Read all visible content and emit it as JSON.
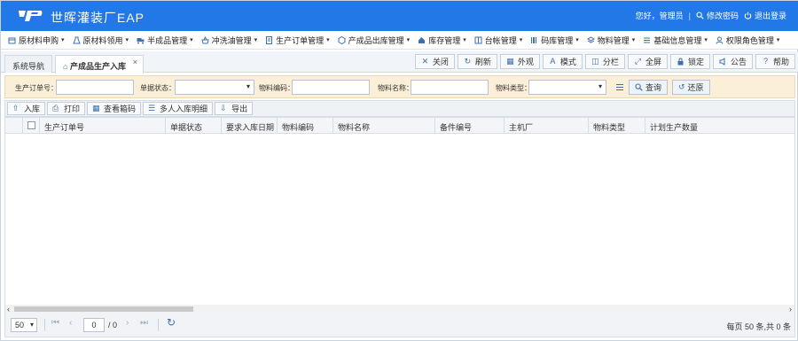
{
  "header": {
    "title": "世晖灌装厂EAP",
    "greeting": "您好，管理员",
    "separator": "|",
    "change_password": "修改密码",
    "logout": "退出登录",
    "brand_color": "#2178e6"
  },
  "menu": [
    {
      "label": "原材料申购",
      "icon": "box-icon"
    },
    {
      "label": "原材料领用",
      "icon": "flask-icon"
    },
    {
      "label": "半成品管理",
      "icon": "truck-icon"
    },
    {
      "label": "冲洗油管理",
      "icon": "basket-icon"
    },
    {
      "label": "生产订单管理",
      "icon": "document-icon"
    },
    {
      "label": "产成品出库管理",
      "icon": "cube-icon"
    },
    {
      "label": "库存管理",
      "icon": "home-icon"
    },
    {
      "label": "台帐管理",
      "icon": "book-icon"
    },
    {
      "label": "码库管理",
      "icon": "barcode-icon"
    },
    {
      "label": "物料管理",
      "icon": "layers-icon"
    },
    {
      "label": "基础信息管理",
      "icon": "sliders-icon"
    },
    {
      "label": "权限角色管理",
      "icon": "user-icon"
    }
  ],
  "tabs": [
    {
      "label": "系统导航"
    },
    {
      "label": "产成品生产入库",
      "close": "×"
    }
  ],
  "tab_tools": [
    {
      "label": "关闭",
      "icon": "close-icon",
      "glyph": "✕"
    },
    {
      "label": "刷新",
      "icon": "refresh-icon",
      "glyph": "↻"
    },
    {
      "label": "外观",
      "icon": "grid-icon",
      "glyph": "▦"
    },
    {
      "label": "模式",
      "icon": "font-icon",
      "glyph": "A"
    },
    {
      "label": "分栏",
      "icon": "columns-icon",
      "glyph": "◫"
    },
    {
      "label": "全屏",
      "icon": "fullscreen-icon",
      "glyph": "⤢"
    },
    {
      "label": "锁定",
      "icon": "lock-icon",
      "glyph": "🔒"
    },
    {
      "label": "公告",
      "icon": "speaker-icon",
      "glyph": "◀"
    },
    {
      "label": "帮助",
      "icon": "help-icon",
      "glyph": "?"
    }
  ],
  "filter": {
    "order_no_label": "生产订单号：",
    "status_label": "单据状态：",
    "material_code_label": "物料编码：",
    "material_name_label": "物料名称：",
    "material_type_label": "物料类型：",
    "search_label": "查询",
    "reset_label": "还原",
    "background": "#fcefd8"
  },
  "actions": [
    {
      "label": "入库",
      "icon": "inbound-icon",
      "glyph": "⇧"
    },
    {
      "label": "打印",
      "icon": "print-icon",
      "glyph": "⎙"
    },
    {
      "label": "查看箱码",
      "icon": "grid-icon",
      "glyph": "▦"
    },
    {
      "label": "多人入库明细",
      "icon": "list-icon",
      "glyph": "☰"
    },
    {
      "label": "导出",
      "icon": "export-icon",
      "glyph": "⇩"
    }
  ],
  "grid": {
    "columns": [
      "生产订单号",
      "单据状态",
      "要求入库日期",
      "物料编码",
      "物料名称",
      "备件编号",
      "主机厂",
      "物料类型",
      "计划生产数量"
    ]
  },
  "pager": {
    "page_size": "50",
    "current_page": "0",
    "total_pages": "/ 0",
    "summary": "每页 50 条,共 0 条"
  }
}
